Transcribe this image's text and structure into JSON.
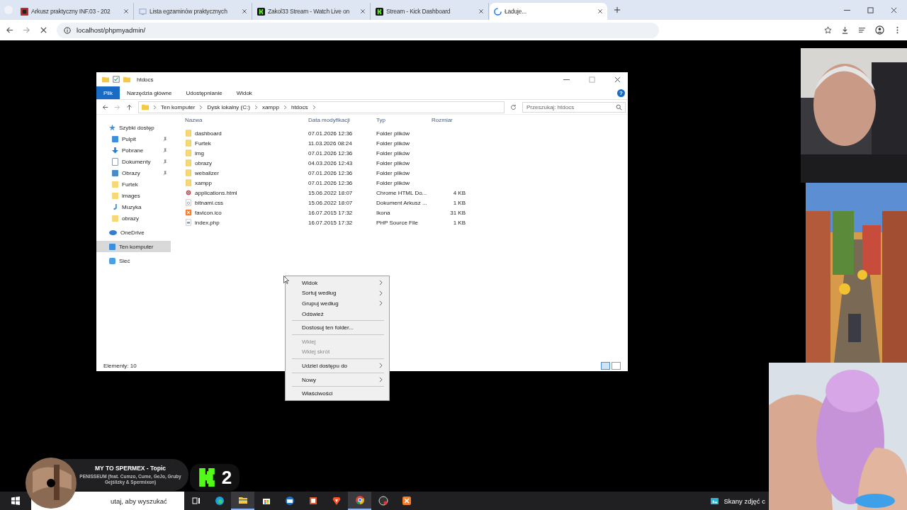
{
  "browser": {
    "tabs": [
      {
        "title": "Arkusz praktyczny INF.03 - 202",
        "kind": "ei",
        "selected": false
      },
      {
        "title": "Lista egzaminów praktycznych",
        "kind": "monitor",
        "selected": false
      },
      {
        "title": "Zakol33 Stream - Watch Live on",
        "kind": "kick",
        "selected": false
      },
      {
        "title": "Stream - Kick Dashboard",
        "kind": "kick",
        "selected": false
      },
      {
        "title": "Ładuje...",
        "kind": "loading",
        "selected": true
      }
    ],
    "url": "localhost/phpmyadmin/"
  },
  "explorer": {
    "title": "htdocs",
    "ribbon_tabs": [
      {
        "label": "Plik",
        "selected": true
      },
      {
        "label": "Narzędzia główne",
        "selected": false
      },
      {
        "label": "Udostępnianie",
        "selected": false
      },
      {
        "label": "Widok",
        "selected": false
      }
    ],
    "breadcrumb": [
      "Ten komputer",
      "Dysk lokalny (C:)",
      "xampp",
      "htdocs"
    ],
    "search": {
      "placeholder": "Przeszukaj: htdocs"
    },
    "columns": [
      "Nazwa",
      "Data modyfikacji",
      "Typ",
      "Rozmiar"
    ],
    "nav": [
      {
        "label": "Szybki dostęp",
        "kind": "star",
        "selected": false,
        "children": [
          {
            "label": "Pulpit",
            "kind": "desktop",
            "pinned": true,
            "selected": false
          },
          {
            "label": "Pobrane",
            "kind": "download",
            "pinned": true,
            "selected": false
          },
          {
            "label": "Dokumenty",
            "kind": "document",
            "pinned": true,
            "selected": false
          },
          {
            "label": "Obrazy",
            "pinned": true,
            "selected": false
          },
          {
            "label": "Furtek",
            "kind": "folder",
            "pinned": false,
            "selected": false
          },
          {
            "label": "images",
            "kind": "folder",
            "pinned": false,
            "selected": false
          },
          {
            "label": "Muzyka",
            "kind": "music",
            "pinned": false,
            "selected": false
          },
          {
            "label": "obrazy",
            "kind": "folder",
            "pinned": false,
            "selected": false
          }
        ]
      },
      {
        "label": "OneDrive",
        "kind": "cloud",
        "selected": false
      },
      {
        "label": "Ten komputer",
        "kind": "computer",
        "selected": true
      },
      {
        "label": "Sieć",
        "kind": "network",
        "selected": false
      }
    ],
    "files": [
      {
        "name": "dashboard",
        "date": "07.01.2026 12:36",
        "type": "Folder plików",
        "kind": "folder"
      },
      {
        "name": "Furtek",
        "date": "11.03.2026 08:24",
        "type": "Folder plików",
        "kind": "folder"
      },
      {
        "name": "img",
        "date": "07.01.2026 12:36",
        "type": "Folder plików",
        "kind": "folder"
      },
      {
        "name": "obrazy",
        "date": "04.03.2026 12:43",
        "type": "Folder plików",
        "kind": "folder"
      },
      {
        "name": "webalizer",
        "date": "07.01.2026 12:36",
        "type": "Folder plików",
        "kind": "folder"
      },
      {
        "name": "xampp",
        "date": "07.01.2026 12:36",
        "type": "Folder plików",
        "kind": "folder"
      },
      {
        "name": "applications.html",
        "date": "15.06.2022 18:07",
        "type": "Chrome HTML Do...",
        "size": "4 KB",
        "kind": "html"
      },
      {
        "name": "bitnami.css",
        "date": "15.06.2022 18:07",
        "type": "Dokument Arkusz ...",
        "size": "1 KB",
        "kind": "css"
      },
      {
        "name": "favicon.ico",
        "date": "16.07.2015 17:32",
        "type": "Ikona",
        "size": "31 KB",
        "kind": "ico"
      },
      {
        "name": "index.php",
        "date": "16.07.2015 17:32",
        "type": "PHP Source File",
        "size": "1 KB",
        "kind": "php"
      }
    ],
    "status": "Elementy: 10",
    "help_label": "?"
  },
  "context_menu": [
    {
      "label": "Widok",
      "submenu": true,
      "disabled": false,
      "divider_after": false
    },
    {
      "label": "Sortuj według",
      "submenu": true,
      "disabled": false,
      "divider_after": false
    },
    {
      "label": "Grupuj według",
      "submenu": true,
      "disabled": false,
      "divider_after": false
    },
    {
      "label": "Odśwież",
      "submenu": false,
      "disabled": false,
      "divider_after": true
    },
    {
      "label": "Dostosuj ten folder...",
      "submenu": false,
      "disabled": false,
      "divider_after": true
    },
    {
      "label": "Wklej",
      "submenu": false,
      "disabled": true,
      "divider_after": false
    },
    {
      "label": "Wklej skrót",
      "submenu": false,
      "disabled": true,
      "divider_after": true
    },
    {
      "label": "Udziel dostępu do",
      "submenu": true,
      "disabled": false,
      "divider_after": true
    },
    {
      "label": "Nowy",
      "submenu": true,
      "disabled": false,
      "divider_after": true
    },
    {
      "label": "Właściwości",
      "submenu": false,
      "disabled": false,
      "divider_after": false
    }
  ],
  "music_overlay": {
    "title": "MY TO SPERMEX - Topic",
    "subtitle": "PENISSEUM (feat. Cumzo, Cume, GeJo, Gruby Gejślizky & Spermixon)"
  },
  "kick_badge": {
    "count": "2"
  },
  "taskbar": {
    "search_placeholder": "utaj, aby wyszukać",
    "apps": [
      {
        "kind": "taskview",
        "active": false
      },
      {
        "kind": "edge",
        "active": false
      },
      {
        "kind": "explorer",
        "active": true
      },
      {
        "kind": "store",
        "active": false
      },
      {
        "kind": "mail",
        "active": false
      },
      {
        "kind": "office",
        "active": false
      },
      {
        "kind": "brave",
        "active": false
      },
      {
        "kind": "chrome",
        "active": true
      },
      {
        "kind": "obs",
        "active": false
      },
      {
        "kind": "xampp",
        "active": false
      }
    ],
    "tray_text": "Skany zdjęć c"
  }
}
